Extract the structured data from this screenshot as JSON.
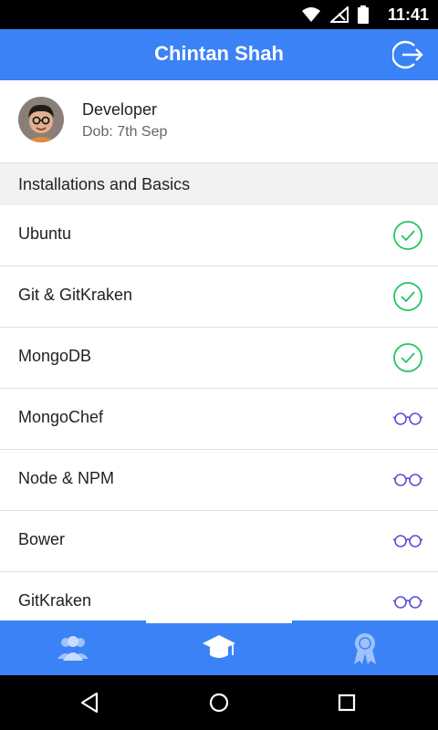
{
  "status_bar": {
    "time": "11:41"
  },
  "header": {
    "title": "Chintan Shah",
    "icon": "logout-icon"
  },
  "profile": {
    "role": "Developer",
    "dob": "Dob: 7th Sep"
  },
  "section": {
    "title": "Installations and Basics"
  },
  "items": [
    {
      "label": "Ubuntu",
      "status": "done"
    },
    {
      "label": "Git & GitKraken",
      "status": "done"
    },
    {
      "label": "MongoDB",
      "status": "done"
    },
    {
      "label": "MongoChef",
      "status": "learning"
    },
    {
      "label": "Node & NPM",
      "status": "learning"
    },
    {
      "label": "Bower",
      "status": "learning"
    },
    {
      "label": "GitKraken",
      "status": "learning"
    }
  ],
  "bottom_nav": {
    "tabs": [
      {
        "icon": "people-icon"
      },
      {
        "icon": "graduation-cap-icon",
        "active": true
      },
      {
        "icon": "award-ribbon-icon"
      }
    ]
  },
  "colors": {
    "primary": "#3b82f6",
    "done": "#22c55e",
    "learning": "#5b4fd6"
  }
}
